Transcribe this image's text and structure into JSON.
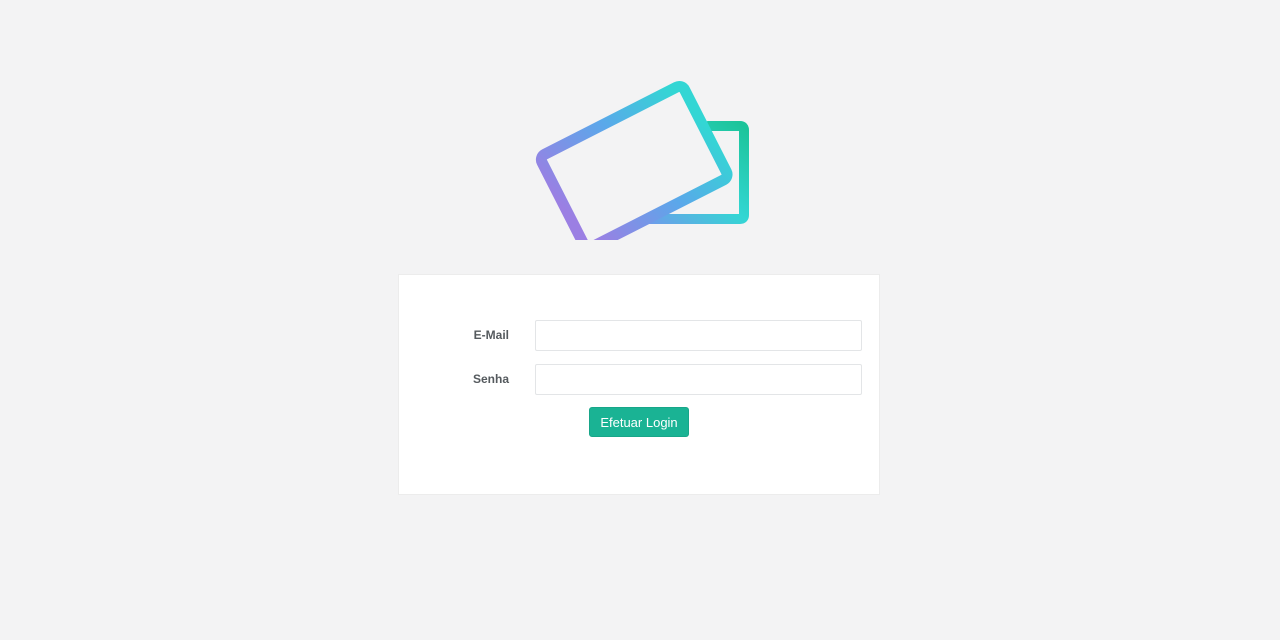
{
  "colors": {
    "background": "#f3f3f4",
    "card": "#ffffff",
    "primary_button": "#1ab394",
    "label_text": "#555a5e",
    "logo_gradient_front": [
      "#9b7fe3",
      "#5aa8ea",
      "#33d6d4"
    ],
    "logo_gradient_back": [
      "#7c8ff0",
      "#33d6d4",
      "#1cc49a"
    ]
  },
  "logo": {
    "icon": "stacked-cards-logo-icon"
  },
  "login_form": {
    "email": {
      "label": "E-Mail",
      "value": "",
      "placeholder": ""
    },
    "password": {
      "label": "Senha",
      "value": "",
      "placeholder": ""
    },
    "submit_label": "Efetuar Login"
  }
}
